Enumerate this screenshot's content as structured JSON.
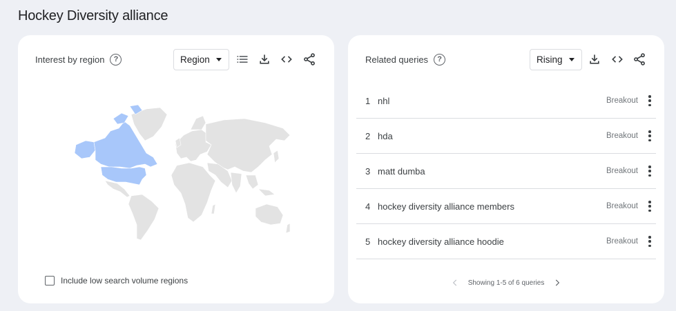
{
  "page": {
    "title": "Hockey Diversity alliance"
  },
  "interest_by_region": {
    "title": "Interest by region",
    "dropdown_value": "Region",
    "checkbox_label": "Include low search volume regions",
    "highlight_color": "#a8c7fa",
    "land_color": "#e3e3e3",
    "icons": [
      "list-icon",
      "download-icon",
      "embed-icon",
      "share-icon"
    ]
  },
  "related_queries": {
    "title": "Related queries",
    "dropdown_value": "Rising",
    "rows": [
      {
        "rank": "1",
        "query": "nhl",
        "value": "Breakout"
      },
      {
        "rank": "2",
        "query": "hda",
        "value": "Breakout"
      },
      {
        "rank": "3",
        "query": "matt dumba",
        "value": "Breakout"
      },
      {
        "rank": "4",
        "query": "hockey diversity alliance members",
        "value": "Breakout"
      },
      {
        "rank": "5",
        "query": "hockey diversity alliance hoodie",
        "value": "Breakout"
      }
    ],
    "pagination": "Showing 1-5 of 6 queries",
    "icons": [
      "download-icon",
      "embed-icon",
      "share-icon"
    ]
  }
}
